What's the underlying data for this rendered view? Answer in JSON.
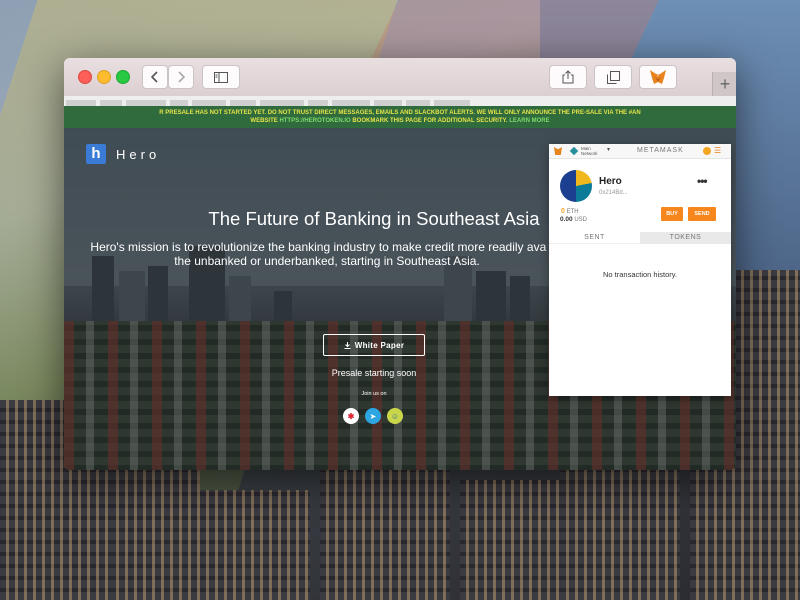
{
  "browser": {
    "toolbar_icons": [
      "back-icon",
      "forward-icon",
      "sidebar-icon",
      "share-icon",
      "tabs-icon",
      "metamask-fox-icon",
      "new-tab-icon"
    ],
    "new_tab_symbol": "+"
  },
  "page": {
    "banner": {
      "line1": "R PRESALE HAS NOT STARTED YET. DO NOT TRUST DIRECT MESSAGES, EMAILS AND SLACKBOT ALERTS. WE WILL ONLY ANNOUNCE THE PRE-SALE VIA THE #AN",
      "line2_prefix": "WEBSITE ",
      "line2_link": "HTTPS://HEROTOKEN.IO",
      "line2_suffix": " BOOKMARK THIS PAGE FOR ADDITIONAL SECURITY. ",
      "line2_more": "LEARN MORE"
    },
    "logo_letter": "h",
    "logo_text": "Hero",
    "headline": "The Future of Banking in Southeast Asia",
    "subline": "Hero's mission is to revolutionize the banking industry to make credit more readily ava for the unbanked or underbanked, starting in Southeast Asia.",
    "white_paper_label": "White Paper",
    "presale_text": "Presale starting soon",
    "join_text": "Join us on",
    "social_icons": [
      "slack-icon",
      "telegram-icon",
      "bot-icon"
    ],
    "colors": {
      "banner_bg": "#2f6b3d",
      "banner_text": "#e6e34a",
      "logo_blue": "#3a7bd5"
    }
  },
  "metamask": {
    "network_line1": "Main",
    "network_line2": "Network",
    "brand": "METAMASK",
    "account_name": "Hero",
    "account_address": "0x214Bd...",
    "eth_amount": "0",
    "eth_unit": "ETH",
    "usd_amount": "0.00",
    "usd_unit": "USD",
    "buy_label": "BUY",
    "send_label": "SEND",
    "tabs": [
      "SENT",
      "TOKENS"
    ],
    "empty_message": "No transaction history.",
    "colors": {
      "accent": "#f7861c"
    }
  }
}
